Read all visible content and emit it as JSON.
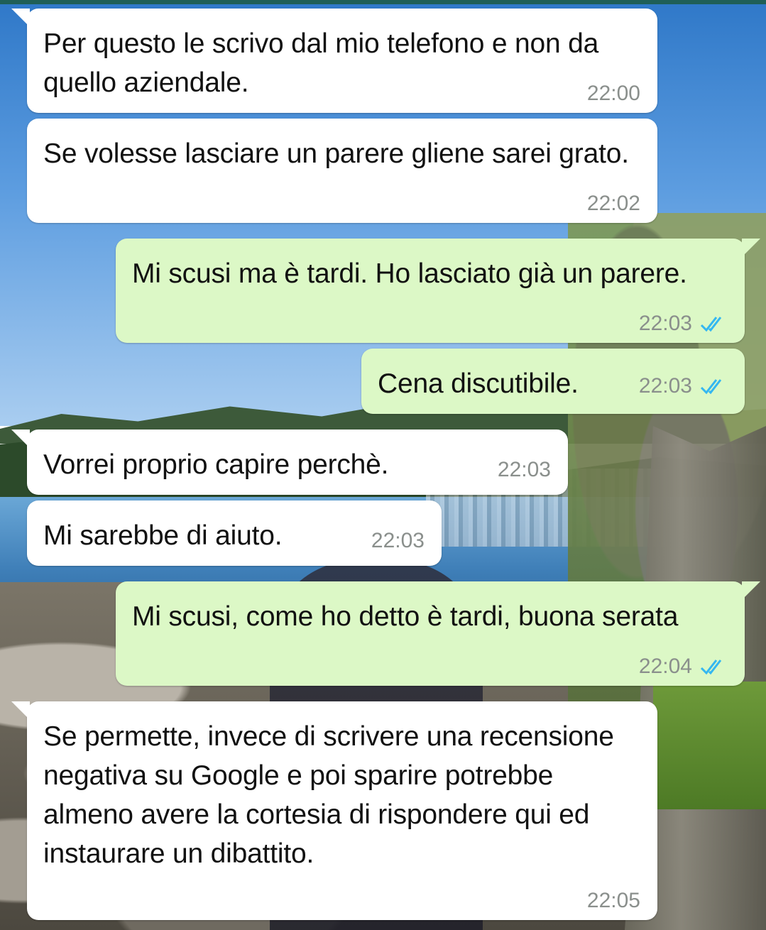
{
  "chat": {
    "messages": [
      {
        "direction": "incoming",
        "text": "Per questo le scrivo dal mio telefono e non da quello aziendale.",
        "time": "22:00"
      },
      {
        "direction": "incoming",
        "text": "Se volesse lasciare un parere gliene sarei grato.",
        "time": "22:02"
      },
      {
        "direction": "outgoing",
        "text": "Mi scusi ma è tardi. Ho lasciato già un parere.",
        "time": "22:03",
        "status": "read"
      },
      {
        "direction": "outgoing",
        "text": "Cena discutibile.",
        "time": "22:03",
        "status": "read"
      },
      {
        "direction": "incoming",
        "text": "Vorrei proprio capire perchè.",
        "time": "22:03"
      },
      {
        "direction": "incoming",
        "text": "Mi sarebbe di aiuto.",
        "time": "22:03"
      },
      {
        "direction": "outgoing",
        "text": "Mi scusi, come ho detto è tardi, buona serata",
        "time": "22:04",
        "status": "read"
      },
      {
        "direction": "incoming",
        "text": "Se permette, invece di scrivere una recensione negativa su Google e poi sparire potrebbe almeno avere la cortesia di rispondere qui ed instaurare un dibattito.",
        "time": "22:05"
      }
    ]
  },
  "colors": {
    "incoming_bubble": "#ffffff",
    "outgoing_bubble": "#dcf8c6",
    "read_ticks": "#34b7f1",
    "timestamp": "#8a8f8c"
  },
  "icons": {
    "read_receipt": "double-check-icon"
  }
}
